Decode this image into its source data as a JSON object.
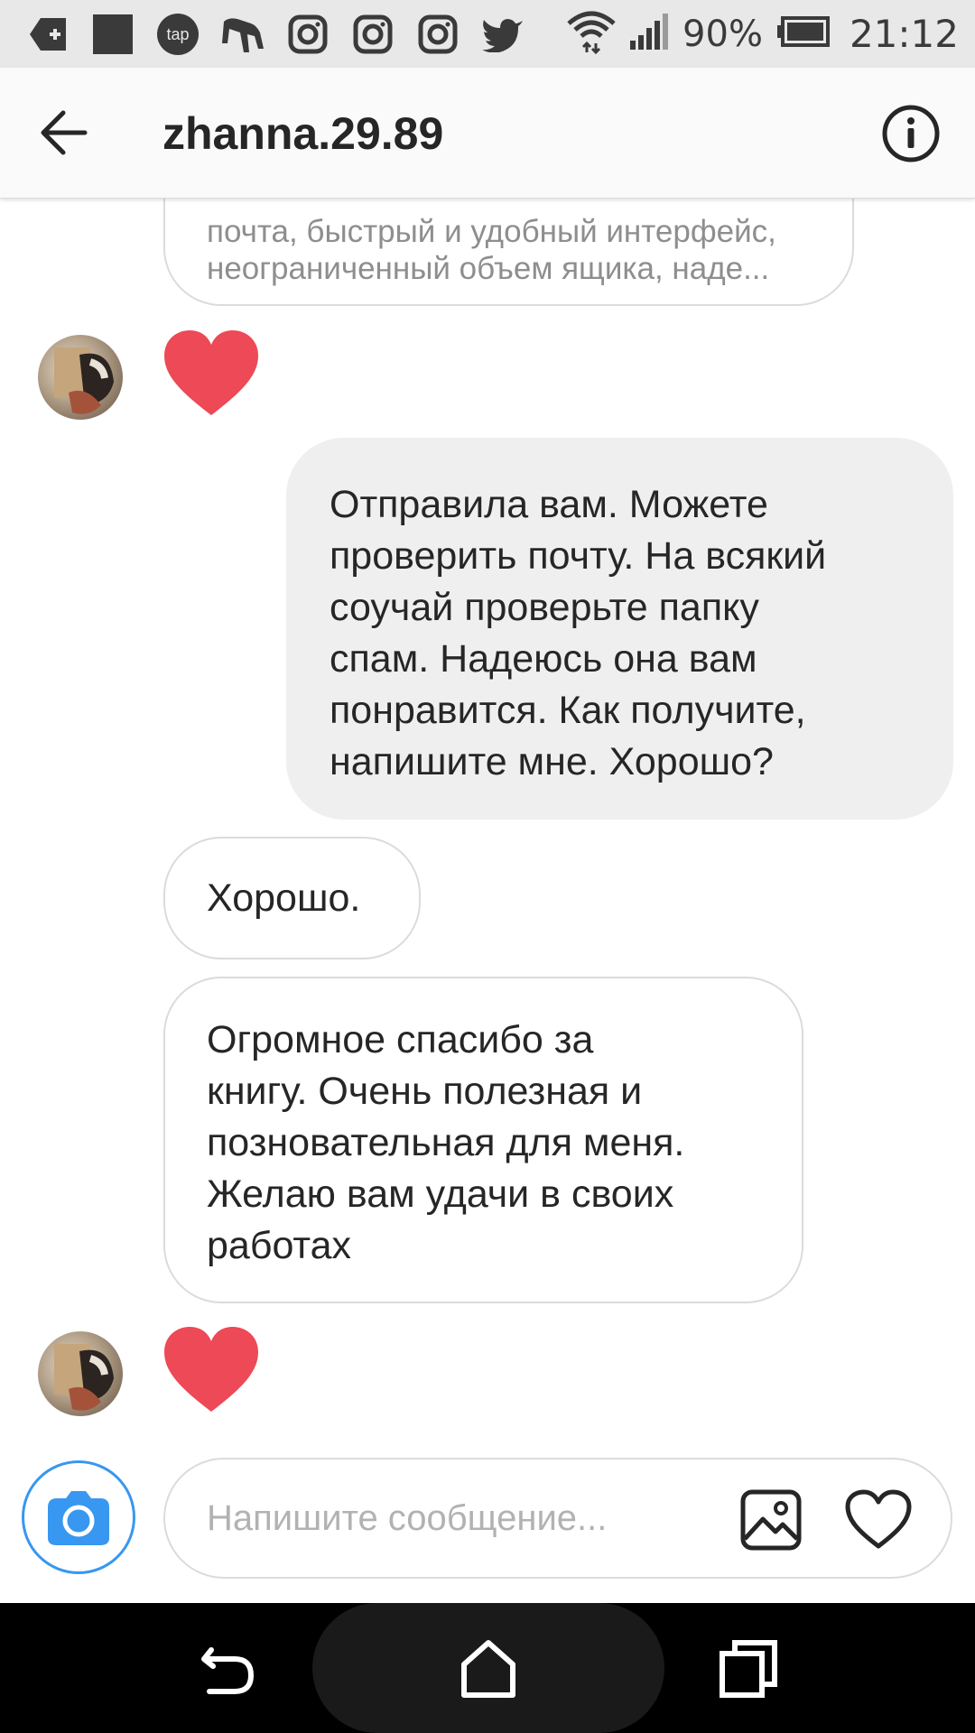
{
  "status_bar": {
    "icons": [
      "add-icon",
      "square-icon",
      "tap-icon",
      "runner-icon",
      "instagram-icon",
      "instagram-icon",
      "instagram-icon",
      "twitter-icon",
      "wifi-icon",
      "signal-icon",
      "battery-icon"
    ],
    "tap_label": "tap",
    "battery": "90%",
    "time": "21:12"
  },
  "header": {
    "title": "zhanna.29.89",
    "back_icon": "arrow-left-icon",
    "info_icon": "info-icon"
  },
  "thread": {
    "preview": {
      "line1": "почта, быстрый и удобный интерфейс,",
      "line2": "неограниченный объем ящика, наде..."
    },
    "outgoing": {
      "lines": [
        "Отправила вам. Можете",
        "проверить почту. На всякий",
        "соучай проверьте папку",
        "спам. Надеюсь она вам",
        "понравится. Как получите,",
        "напишите мне. Хорошо?"
      ]
    },
    "incoming_short": "Хорошо.",
    "incoming_long": {
      "lines": [
        "Огромное спасибо за",
        "книгу. Очень полезная и",
        "позновательная для меня.",
        "Желаю вам удачи в своих",
        "работах"
      ]
    },
    "heart_color": "#ed4956"
  },
  "composer": {
    "placeholder": "Напишите сообщение...",
    "accent": "#3897f0"
  },
  "nav": {
    "icons": [
      "back-nav-icon",
      "home-icon",
      "recents-icon"
    ]
  }
}
